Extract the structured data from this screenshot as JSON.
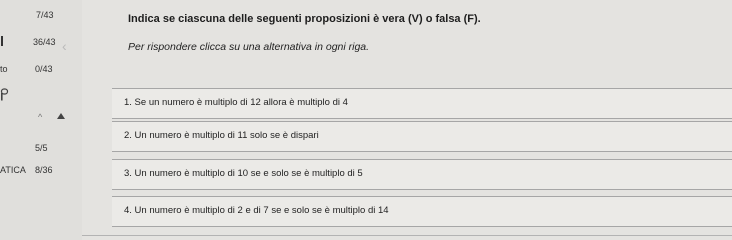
{
  "sidebar": {
    "counter_a": "7/43",
    "counter_b": "36/43",
    "counter_c_prefix": "to",
    "counter_c": "0/43",
    "section_count": "5/5",
    "section_label": "ATICA",
    "section_progress": "8/36"
  },
  "main": {
    "title": "Indica se ciascuna delle seguenti proposizioni è vera (V) o falsa (F).",
    "subtitle": "Per rispondere clicca su una alternativa in ogni riga.",
    "items": [
      "1. Se un numero è multiplo di 12 allora è multiplo di 4",
      "2. Un numero è multiplo di 11 solo se è dispari",
      "3. Un numero è multiplo di 10 se e solo se è multiplo di 5",
      "4. Un numero è multiplo di 2 e di 7 se e solo se è multiplo di 14"
    ]
  },
  "colors": {
    "background": "#e4e3e0",
    "row_background": "#ebeae7",
    "row_border": "#a6a6a6"
  }
}
